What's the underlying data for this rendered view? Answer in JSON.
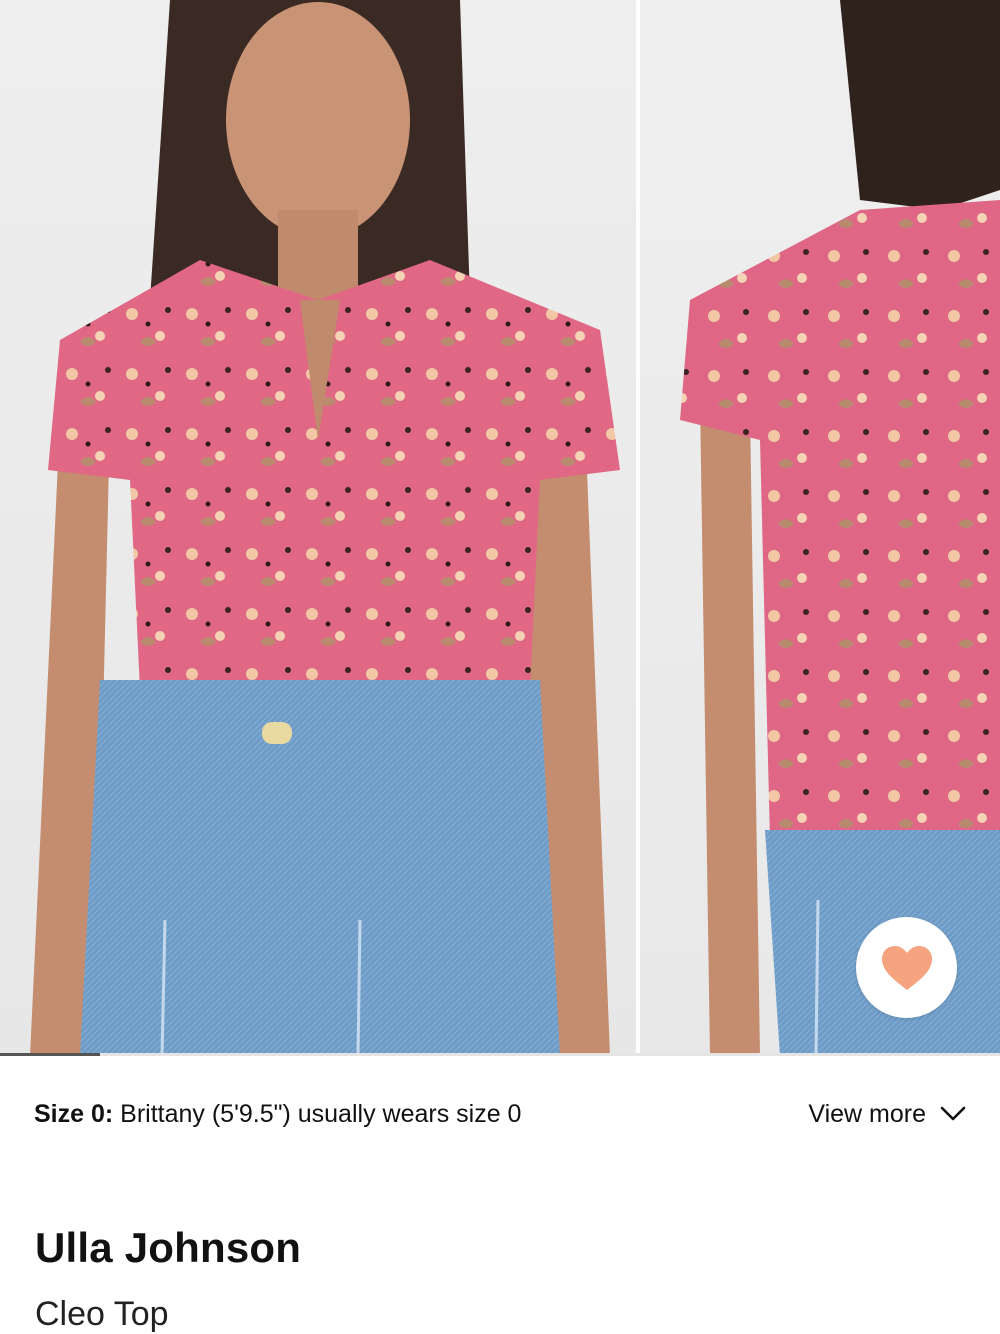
{
  "gallery": {
    "images": [
      {
        "name": "front-view"
      },
      {
        "name": "back-view"
      }
    ],
    "progress": 0.1
  },
  "favorite": {
    "icon": "heart-icon",
    "color": "#f6a37f"
  },
  "size_info": {
    "label": "Size 0:",
    "text": " Brittany (5'9.5\") usually wears size 0",
    "view_more": "View more",
    "view_more_icon": "chevron-down-icon"
  },
  "product": {
    "brand": "Ulla Johnson",
    "name": "Cleo Top"
  },
  "colors": {
    "top_pink": "#e26a86",
    "denim": "#6f9cc6"
  }
}
